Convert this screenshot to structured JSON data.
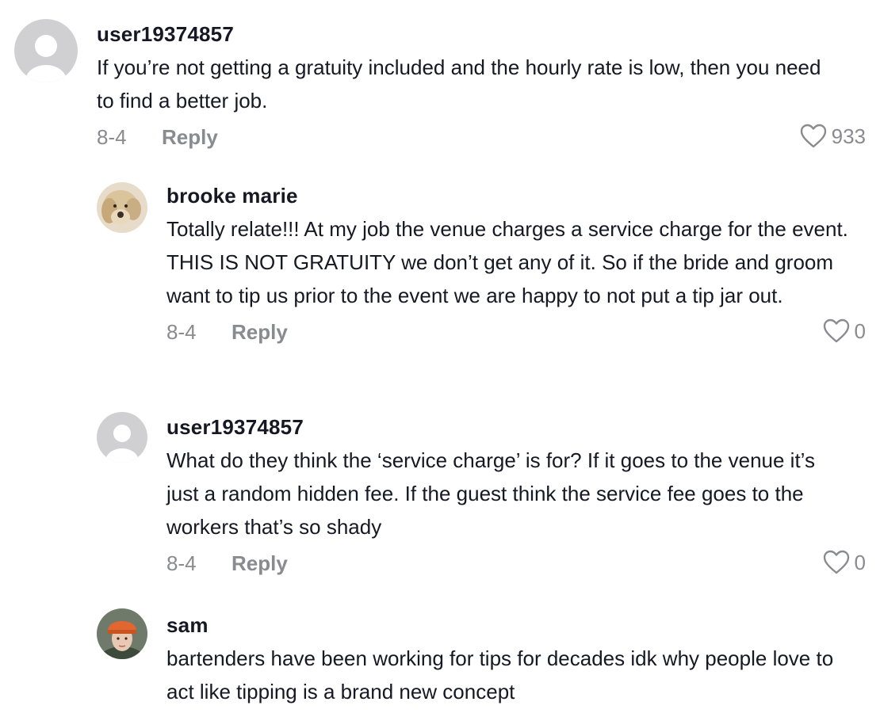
{
  "comments": [
    {
      "username": "user19374857",
      "text": "If you’re not getting a gratuity included and the hourly rate is low, then you need to find a better job.",
      "date": "8-4",
      "reply_label": "Reply",
      "likes": "933",
      "avatar": "default-avatar-icon"
    },
    {
      "username": "brooke marie",
      "text": "Totally relate!!! At my job the venue charges a service charge for the event. THIS IS NOT GRATUITY we don’t get any of it. So if the bride and groom want to tip us prior to the event we are happy to not put a tip jar out.",
      "date": "8-4",
      "reply_label": "Reply",
      "likes": "0",
      "avatar": "dog-photo"
    },
    {
      "username": "user19374857",
      "text": "What do they think the ‘service charge’ is for? If it goes to the venue it’s just a random hidden fee. If the guest think the service fee goes to the workers that’s so shady",
      "date": "8-4",
      "reply_label": "Reply",
      "likes": "0",
      "avatar": "default-avatar-icon"
    },
    {
      "username": "sam",
      "text": "bartenders have been working for tips for decades idk why people love to act like tipping is a brand new concept",
      "avatar": "person-photo"
    }
  ],
  "colors": {
    "text": "#161823",
    "muted": "#8a8b91",
    "avatar_bg": "#d0d0d3",
    "orange_beanie": "#e2662f"
  }
}
